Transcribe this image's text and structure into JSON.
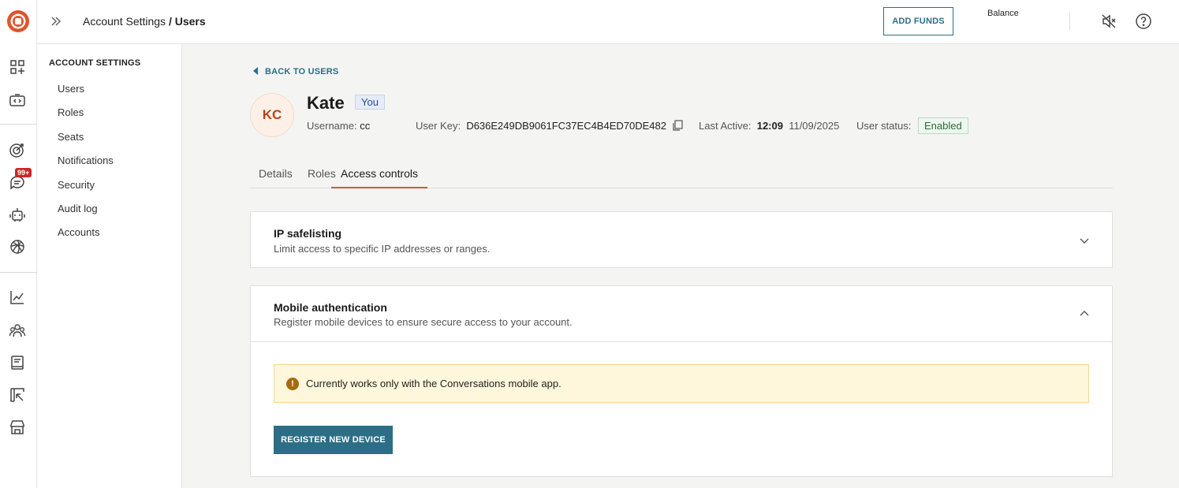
{
  "topbar": {
    "breadcrumb_parent": "Account Settings",
    "breadcrumb_sep": " / ",
    "breadcrumb_current": "Users",
    "add_funds_label": "ADD FUNDS",
    "balance_label": "Balance"
  },
  "rail": {
    "badge": "99+",
    "icons": [
      "logo-icon",
      "apps-icon",
      "code-icon",
      "target-icon",
      "chat-icon",
      "bot-icon",
      "ai-icon",
      "chart-icon",
      "people-icon",
      "book-icon",
      "pointer-icon",
      "store-icon"
    ],
    "brand_color": "#e0542b"
  },
  "sidebar": {
    "heading": "ACCOUNT SETTINGS",
    "items": [
      {
        "label": "Users"
      },
      {
        "label": "Roles"
      },
      {
        "label": "Seats"
      },
      {
        "label": "Notifications"
      },
      {
        "label": "Security"
      },
      {
        "label": "Audit log"
      },
      {
        "label": "Accounts"
      }
    ]
  },
  "user": {
    "back_label": "BACK TO USERS",
    "initials": "KC",
    "name": "Kate",
    "you_badge": "You",
    "username_label": "Username:",
    "username": "cc",
    "user_key_label": "User Key:",
    "user_key": "D636E249DB9061FC37EC4B4ED70DE482",
    "last_active_label": "Last Active:",
    "last_active_time": "12:09",
    "last_active_date": "11/09/2025",
    "status_label": "User status:",
    "status": "Enabled"
  },
  "tabs": [
    {
      "label": "Details"
    },
    {
      "label": "Roles"
    },
    {
      "label": "Access controls",
      "active": true
    }
  ],
  "ip_card": {
    "title": "IP safelisting",
    "subtitle": "Limit access to specific IP addresses or ranges.",
    "expanded": false
  },
  "mobile_card": {
    "title": "Mobile authentication",
    "subtitle": "Register mobile devices to ensure secure access to your account.",
    "expanded": true,
    "alert_icon": "!",
    "alert": "Currently works only with the Conversations mobile app.",
    "register_label": "REGISTER NEW DEVICE"
  },
  "colors": {
    "accent": "#2c6e86",
    "tab_underline": "#e0542b",
    "alert_bg": "#fff7dc"
  }
}
